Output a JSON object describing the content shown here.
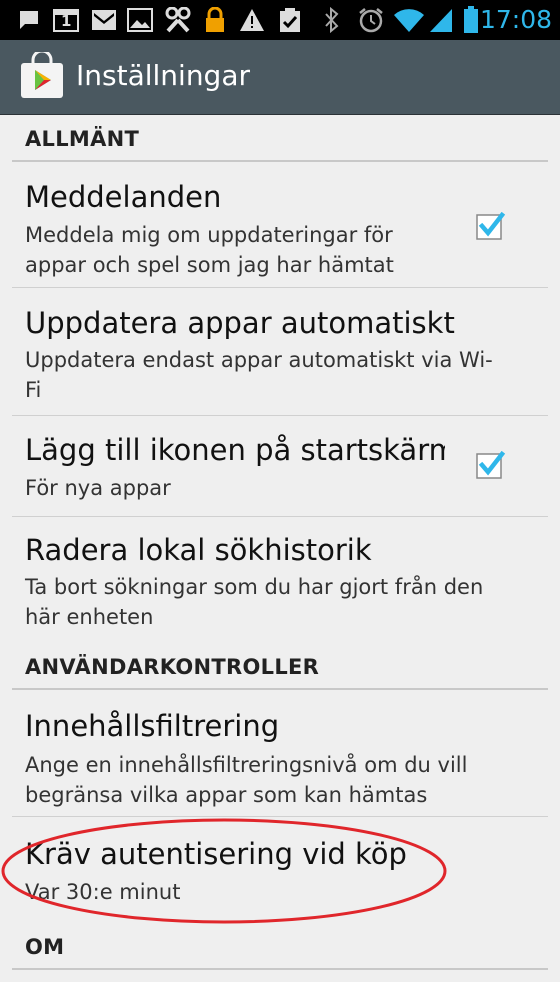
{
  "status_bar": {
    "time": "17:08",
    "icons": [
      "message-icon",
      "calendar-icon",
      "gmail-icon",
      "image-icon",
      "tools-icon",
      "lock-icon",
      "warning-icon",
      "clipboard-check-icon",
      "bluetooth-icon",
      "alarm-icon",
      "wifi-icon",
      "signal-icon",
      "battery-icon"
    ],
    "calendar_day": "1"
  },
  "action_bar": {
    "title": "Inställningar"
  },
  "sections": {
    "general": "ALLMÄNT",
    "user_controls": "ANVÄNDARKONTROLLER",
    "about": "OM"
  },
  "prefs": {
    "notifications": {
      "title": "Meddelanden",
      "summary_line1": "Meddela mig om uppdateringar för",
      "summary_line2": "appar och spel som jag har hämtat",
      "checked": true
    },
    "auto_update": {
      "title": "Uppdatera appar automatiskt",
      "summary_line1": "Uppdatera endast appar automatiskt via Wi-",
      "summary_line2": "Fi"
    },
    "add_icon": {
      "title": "Lägg till ikonen på startskärm",
      "summary_line1": "För nya appar",
      "checked": true
    },
    "clear_history": {
      "title": "Radera lokal sökhistorik",
      "summary_line1": "Ta bort sökningar som du har gjort från den",
      "summary_line2": "här enheten"
    },
    "content_filter": {
      "title": "Innehållsfiltrering",
      "summary_line1": "Ange en innehållsfiltreringsnivå om du vill",
      "summary_line2": "begränsa vilka appar som kan hämtas"
    },
    "require_auth": {
      "title": "Kräv autentisering vid köp",
      "summary_line1": "Var 30:e minut"
    }
  },
  "colors": {
    "background": "#efefef",
    "action_bar": "#4a5860",
    "accent": "#2fb7ea",
    "annotation_red": "#e0262b"
  }
}
